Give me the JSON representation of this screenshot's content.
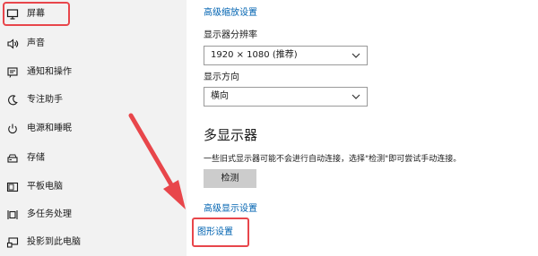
{
  "sidebar": {
    "items": [
      {
        "label": "屏幕",
        "icon": "monitor-icon",
        "selected": true
      },
      {
        "label": "声音",
        "icon": "speaker-icon"
      },
      {
        "label": "通知和操作",
        "icon": "notification-icon"
      },
      {
        "label": "专注助手",
        "icon": "moon-icon"
      },
      {
        "label": "电源和睡眠",
        "icon": "power-icon"
      },
      {
        "label": "存储",
        "icon": "storage-icon"
      },
      {
        "label": "平板电脑",
        "icon": "tablet-icon"
      },
      {
        "label": "多任务处理",
        "icon": "multitask-icon"
      },
      {
        "label": "投影到此电脑",
        "icon": "project-icon"
      }
    ]
  },
  "main": {
    "advanced_scaling_link": "高级缩放设置",
    "resolution_label": "显示器分辨率",
    "resolution_value": "1920 × 1080 (推荐)",
    "orientation_label": "显示方向",
    "orientation_value": "横向",
    "multi_display_heading": "多显示器",
    "multi_display_desc": "一些旧式显示器可能不会进行自动连接，选择\"检测\"即可尝试手动连接。",
    "detect_button": "检测",
    "advanced_display_link": "高级显示设置",
    "graphics_settings_link": "图形设置"
  },
  "colors": {
    "accent_link": "#0063b1",
    "highlight_red": "#e8464b",
    "sidebar_bg": "#f2f2f2",
    "button_bg": "#cccccc"
  }
}
